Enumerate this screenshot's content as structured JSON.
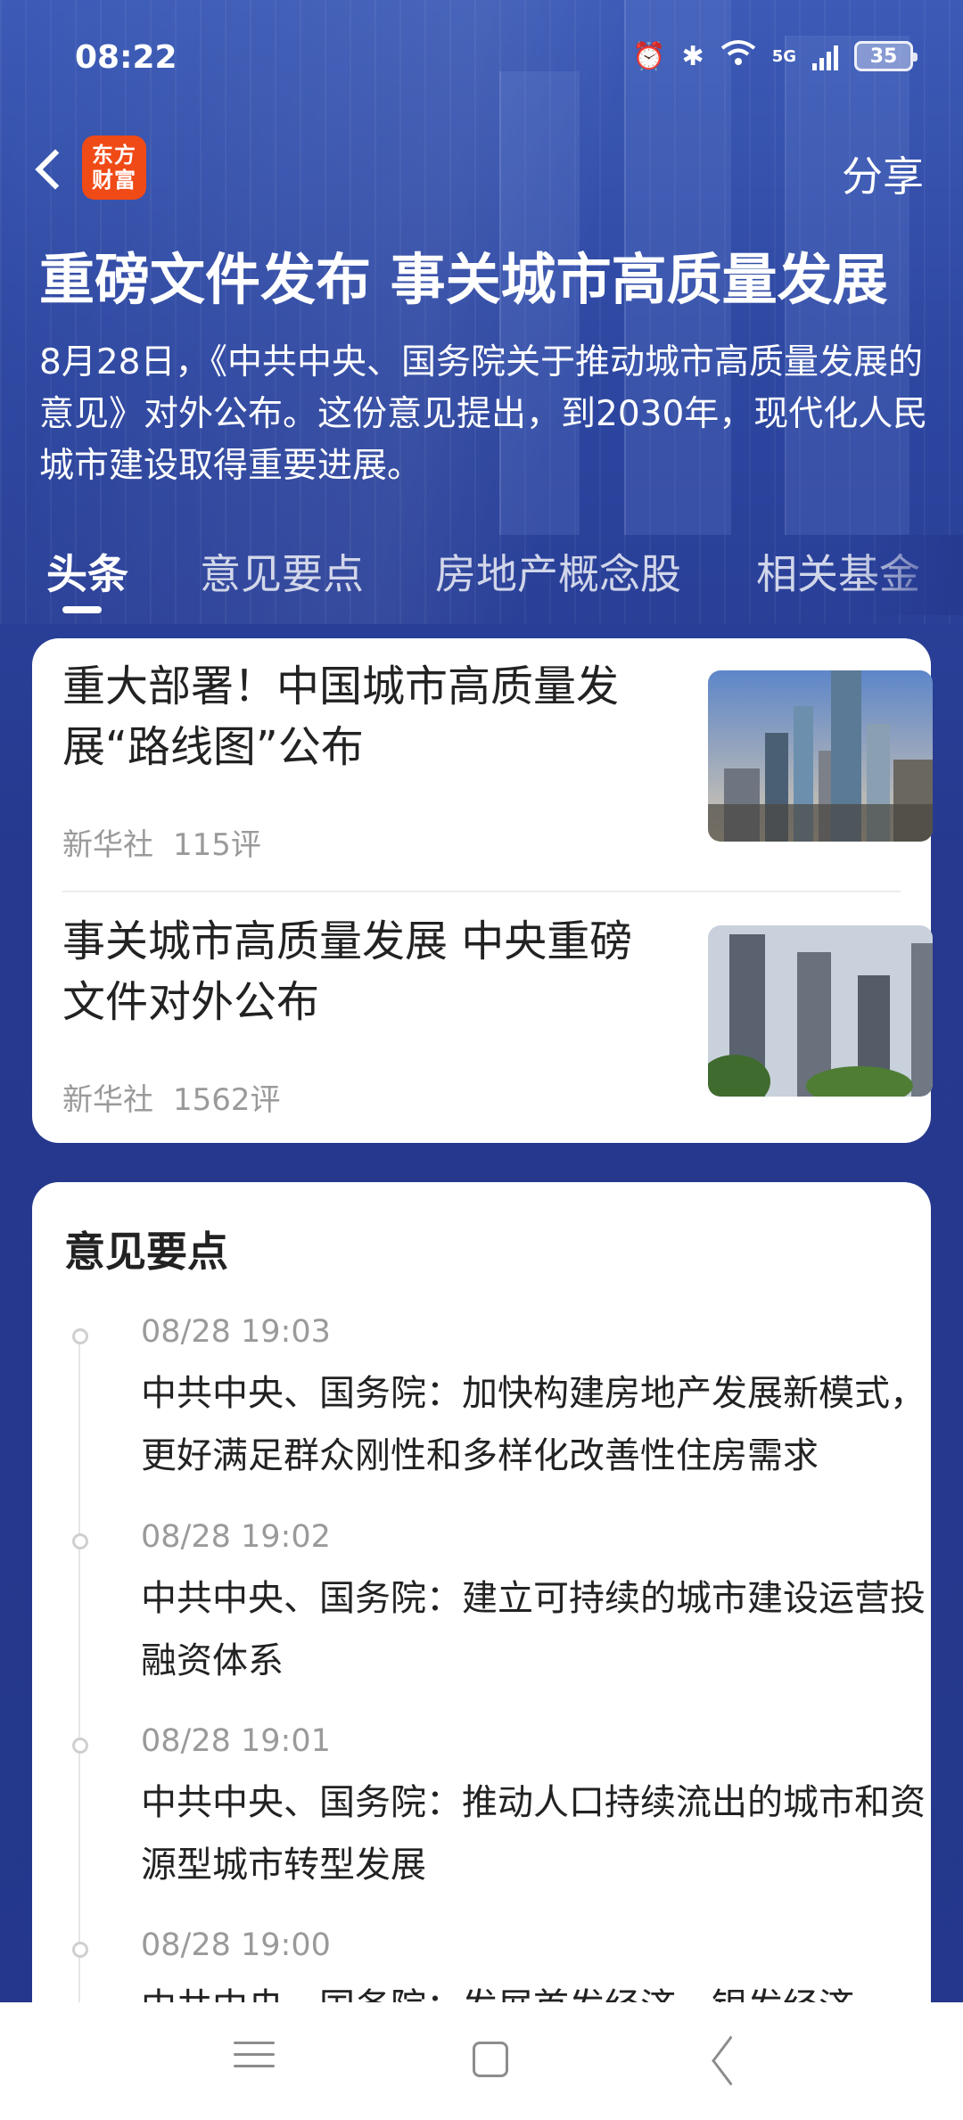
{
  "status_bar": {
    "time": "08:22",
    "network": "5G",
    "battery": "35"
  },
  "nav": {
    "logo_text": "东方财富",
    "share_label": "分享"
  },
  "hero": {
    "title": "重磅文件发布 事关城市高质量发展",
    "description": "8月28日，《中共中央、国务院关于推动城市高质量发展的意见》对外公布。这份意见提出，到2030年，现代化人民城市建设取得重要进展。"
  },
  "tabs": [
    {
      "label": "头条",
      "active": true
    },
    {
      "label": "意见要点",
      "active": false
    },
    {
      "label": "房地产概念股",
      "active": false
    },
    {
      "label": "相关基金",
      "active": false
    }
  ],
  "news": [
    {
      "title": "重大部署！中国城市高质量发展“路线图”公布",
      "source": "新华社",
      "comments": "115评"
    },
    {
      "title": "事关城市高质量发展 中央重磅文件对外公布",
      "source": "新华社",
      "comments": "1562评"
    }
  ],
  "points": {
    "heading": "意见要点",
    "items": [
      {
        "time": "08/28 19:03",
        "text": "中共中央、国务院：加快构建房地产发展新模式，更好满足群众刚性和多样化改善性住房需求"
      },
      {
        "time": "08/28 19:02",
        "text": "中共中央、国务院：建立可持续的城市建设运营投融资体系"
      },
      {
        "time": "08/28 19:01",
        "text": "中共中央、国务院：推动人口持续流出的城市和资源型城市转型发展"
      },
      {
        "time": "08/28 19:00",
        "text": "中共中央、国务院：发展首发经济、银发经济"
      }
    ]
  },
  "colors": {
    "header_blue": "#2d46a0",
    "logo_orange": "#f04a16"
  }
}
